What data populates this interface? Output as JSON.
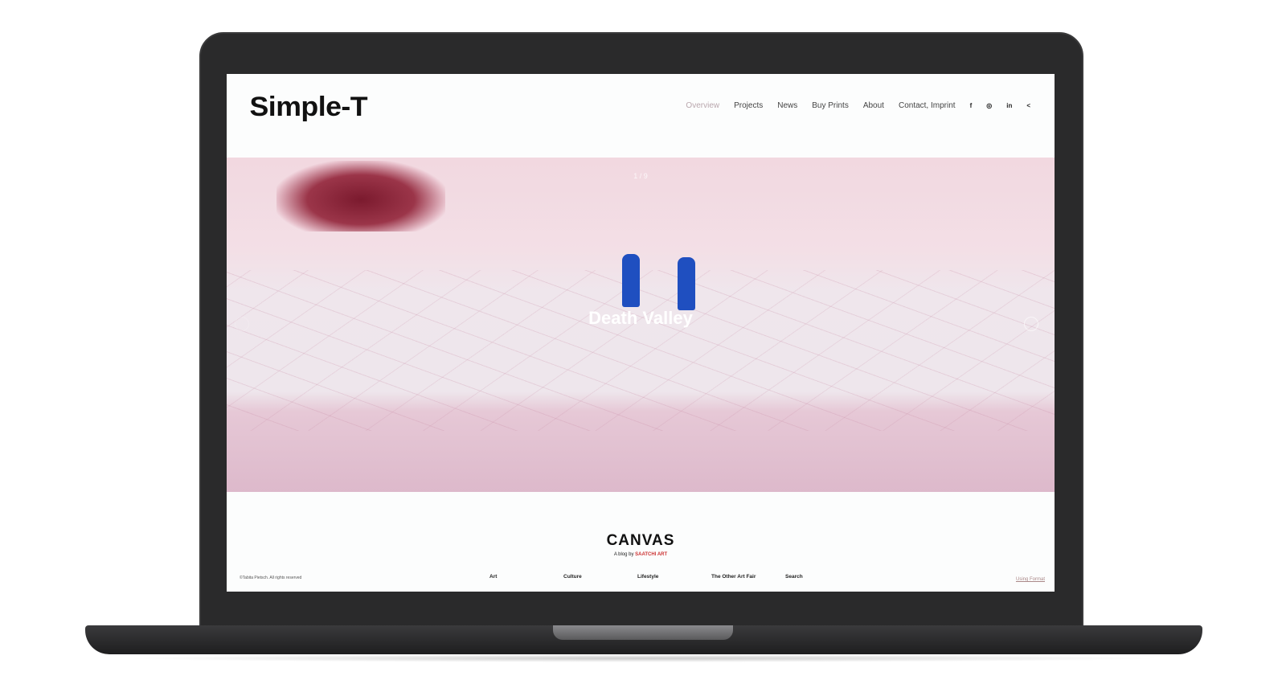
{
  "header": {
    "logo": "Simple-T",
    "nav": [
      "Overview",
      "Projects",
      "News",
      "Buy Prints",
      "About",
      "Contact, Imprint"
    ],
    "active": "Overview",
    "social": [
      {
        "icon": "facebook-icon",
        "glyph": "f"
      },
      {
        "icon": "instagram-icon",
        "glyph": "◎"
      },
      {
        "icon": "linkedin-icon",
        "glyph": "in"
      },
      {
        "icon": "share-icon",
        "glyph": "<"
      }
    ]
  },
  "hero": {
    "counter": "1 / 9",
    "title": "Death Valley"
  },
  "footer": {
    "brand": "CANVAS",
    "tagline": "A blog by",
    "tagline_brand": "SAATCHI ART",
    "copyright": "©Tabita Pietsch. All rights reserved",
    "nav": [
      "Art",
      "Culture",
      "Lifestyle",
      "The Other Art Fair",
      "Search"
    ],
    "using": "Using Format"
  },
  "colors": {
    "accent": "#b9a7ad",
    "hero_pink": "#f2d8e0",
    "device": "#2a2a2b"
  }
}
